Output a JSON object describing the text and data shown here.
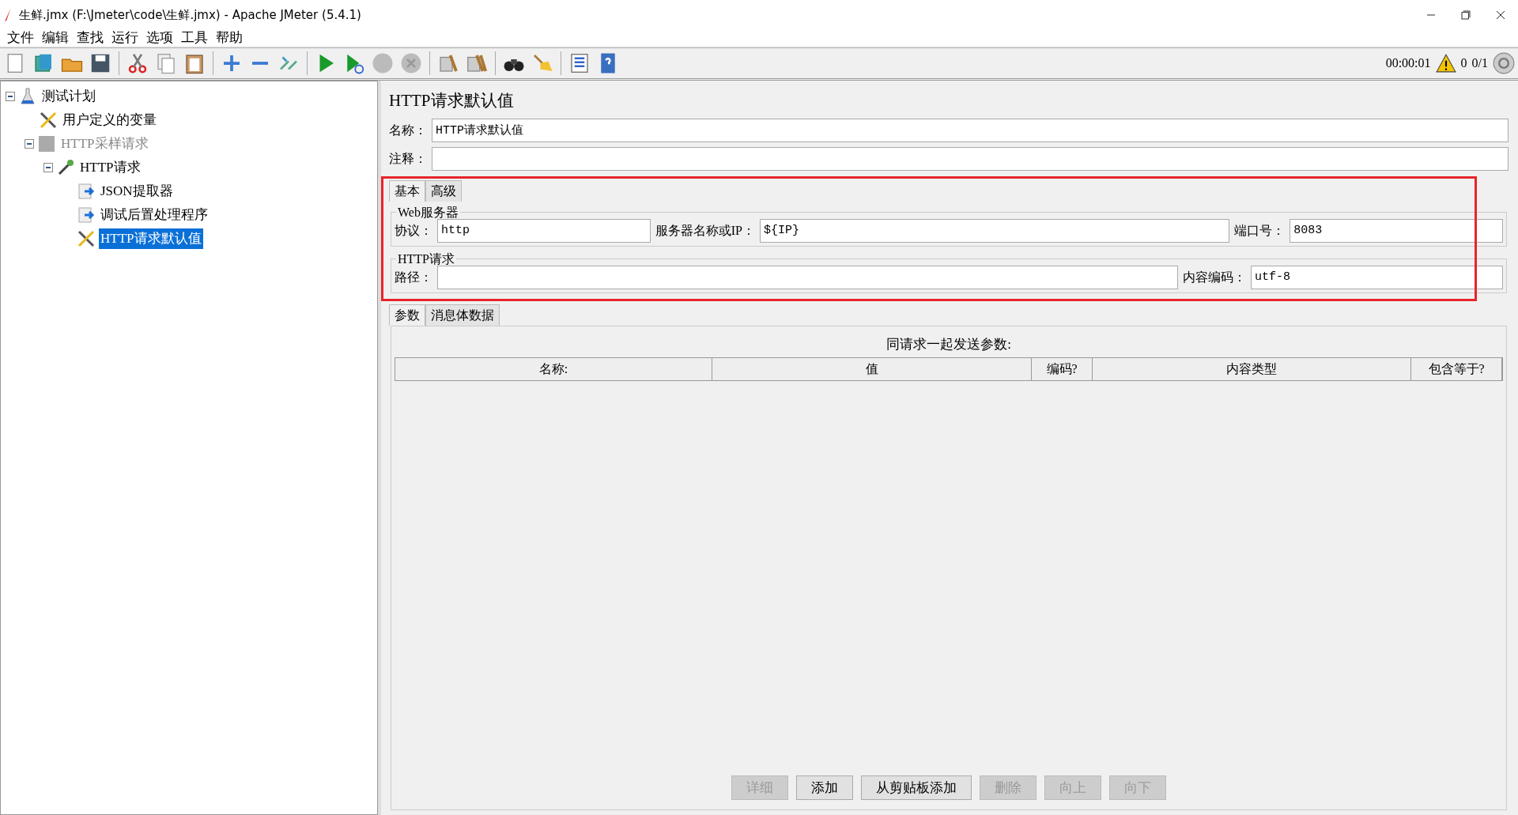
{
  "window": {
    "title": "生鲜.jmx (F:\\Jmeter\\code\\生鲜.jmx) - Apache JMeter (5.4.1)"
  },
  "menu": [
    "文件",
    "编辑",
    "查找",
    "运行",
    "选项",
    "工具",
    "帮助"
  ],
  "status": {
    "elapsed": "00:00:01",
    "warnings": "0",
    "threads": "0/1"
  },
  "tree": [
    {
      "label": "测试计划",
      "kind": "plan",
      "selected": false,
      "disabled": false,
      "expanded": true,
      "children": [
        {
          "label": "用户定义的变量",
          "kind": "config",
          "selected": false,
          "disabled": false
        },
        {
          "label": "HTTP采样请求",
          "kind": "group",
          "selected": false,
          "disabled": true,
          "expanded": true,
          "children": [
            {
              "label": "HTTP请求",
              "kind": "sampler",
              "selected": false,
              "disabled": false,
              "expanded": true,
              "children": [
                {
                  "label": "JSON提取器",
                  "kind": "post",
                  "selected": false,
                  "disabled": false
                },
                {
                  "label": "调试后置处理程序",
                  "kind": "post",
                  "selected": false,
                  "disabled": false
                },
                {
                  "label": "HTTP请求默认值",
                  "kind": "config",
                  "selected": true,
                  "disabled": false
                }
              ]
            }
          ]
        }
      ]
    }
  ],
  "editor": {
    "title": "HTTP请求默认值",
    "name": {
      "label": "名称：",
      "value": "HTTP请求默认值"
    },
    "comment": {
      "label": "注释："
    },
    "tabs": [
      {
        "label": "基本",
        "selected": true
      },
      {
        "label": "高级",
        "selected": false
      }
    ],
    "web_server": {
      "legend": "Web服务器",
      "fields": [
        {
          "label": "协议：",
          "value": "http"
        },
        {
          "label": "服务器名称或IP：",
          "value": "${IP}"
        },
        {
          "label": "端口号：",
          "value": "8083"
        }
      ]
    },
    "http_request": {
      "legend": "HTTP请求",
      "fields": [
        {
          "label": "路径："
        },
        {
          "label": "内容编码：",
          "value": "utf-8"
        }
      ]
    },
    "subtabs": [
      {
        "label": "参数",
        "selected": true
      },
      {
        "label": "消息体数据",
        "selected": false
      }
    ],
    "params": {
      "caption": "同请求一起发送参数:",
      "columns": [
        "名称:",
        "值",
        "编码?",
        "内容类型",
        "包含等于?"
      ]
    },
    "buttons": [
      {
        "label": "详细",
        "disabled": true
      },
      {
        "label": "添加",
        "disabled": false
      },
      {
        "label": "从剪贴板添加",
        "disabled": false
      },
      {
        "label": "删除",
        "disabled": true
      },
      {
        "label": "向上",
        "disabled": true
      },
      {
        "label": "向下",
        "disabled": true
      }
    ]
  },
  "annotation_box": true
}
